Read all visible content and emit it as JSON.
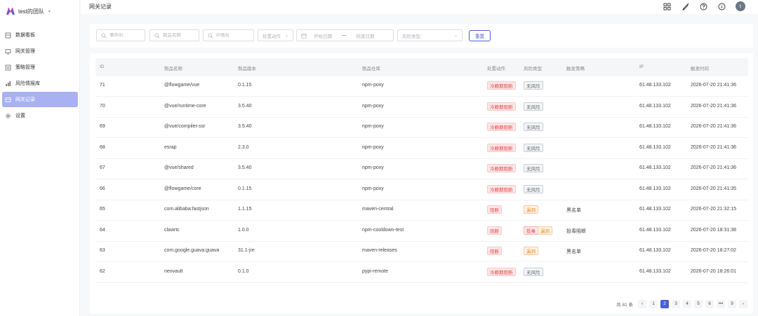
{
  "sidebar": {
    "team_name": "test的团队",
    "items": [
      {
        "label": "数据看板",
        "icon": "dashboard-icon"
      },
      {
        "label": "网关管理",
        "icon": "monitor-icon"
      },
      {
        "label": "策略管理",
        "icon": "policy-icon"
      },
      {
        "label": "风险情报库",
        "icon": "chart-icon"
      },
      {
        "label": "网关记录",
        "icon": "record-icon",
        "active": true
      },
      {
        "label": "设置",
        "icon": "gear-icon"
      }
    ]
  },
  "header": {
    "title": "网关记录",
    "avatar_letter": "t"
  },
  "filters": {
    "event_id_placeholder": "事件ID",
    "product_name_placeholder": "制品名称",
    "ip_placeholder": "IP地址",
    "action_placeholder": "处置动作",
    "start_date_placeholder": "开始日期",
    "date_separator": "—",
    "end_date_placeholder": "结束日期",
    "risk_type_placeholder": "风险类型",
    "reset_label": "重置"
  },
  "table": {
    "columns": {
      "id": "ID",
      "name": "制品名称",
      "version": "制品版本",
      "repo": "制品仓库",
      "action": "处置动作",
      "risk": "风险类型",
      "policy": "触发策略",
      "ip": "IP",
      "time": "触发时间"
    },
    "rows": [
      {
        "id": "71",
        "name": "@flowgame/vue",
        "version": "0.1.15",
        "repo": "npm-poxy",
        "action": "冷静期阻断",
        "action_color": "red",
        "risks": [
          {
            "label": "无风险",
            "color": "gray"
          }
        ],
        "policy": "",
        "ip": "61.48.133.102",
        "time": "2026-07-20 21:41:36"
      },
      {
        "id": "70",
        "name": "@vue/runtime-core",
        "version": "3.5.40",
        "repo": "npm-poxy",
        "action": "冷静期阻断",
        "action_color": "red",
        "risks": [
          {
            "label": "无风险",
            "color": "gray"
          }
        ],
        "policy": "",
        "ip": "61.48.133.102",
        "time": "2026-07-20 21:41:36"
      },
      {
        "id": "69",
        "name": "@vue/compiler-ssr",
        "version": "3.5.40",
        "repo": "npm-poxy",
        "action": "冷静期阻断",
        "action_color": "red",
        "risks": [
          {
            "label": "无风险",
            "color": "gray"
          }
        ],
        "policy": "",
        "ip": "61.48.133.102",
        "time": "2026-07-20 21:41:36"
      },
      {
        "id": "68",
        "name": "esrap",
        "version": "2.3.0",
        "repo": "npm-poxy",
        "action": "冷静期阻断",
        "action_color": "red",
        "risks": [
          {
            "label": "无风险",
            "color": "gray"
          }
        ],
        "policy": "",
        "ip": "61.48.133.102",
        "time": "2026-07-20 21:41:36"
      },
      {
        "id": "67",
        "name": "@vue/shared",
        "version": "3.5.40",
        "repo": "npm-poxy",
        "action": "冷静期阻断",
        "action_color": "red",
        "risks": [
          {
            "label": "无风险",
            "color": "gray"
          }
        ],
        "policy": "",
        "ip": "61.48.133.102",
        "time": "2026-07-20 21:41:36"
      },
      {
        "id": "66",
        "name": "@flowgame/core",
        "version": "0.1.15",
        "repo": "npm-poxy",
        "action": "冷静期阻断",
        "action_color": "red",
        "risks": [
          {
            "label": "无风险",
            "color": "gray"
          }
        ],
        "policy": "",
        "ip": "61.48.133.102",
        "time": "2026-07-20 21:41:35"
      },
      {
        "id": "65",
        "name": "com.alibaba:fastjson",
        "version": "1.1.15",
        "repo": "maven-central",
        "action": "阻断",
        "action_color": "red",
        "risks": [
          {
            "label": "漏洞",
            "color": "orange"
          }
        ],
        "policy": "黑名单",
        "ip": "61.48.133.102",
        "time": "2026-07-20 21:32:15"
      },
      {
        "id": "64",
        "name": "clawrtc",
        "version": "1.0.0",
        "repo": "npm-cooldown-test",
        "action": "阻断",
        "action_color": "red",
        "risks": [
          {
            "label": "投毒",
            "color": "pink"
          },
          {
            "label": "漏洞",
            "color": "orange"
          }
        ],
        "policy": "投毒阻断",
        "ip": "61.48.133.102",
        "time": "2026-07-20 18:31:38"
      },
      {
        "id": "63",
        "name": "com.google.guava:guava",
        "version": "31.1-jre",
        "repo": "maven-releases",
        "action": "阻断",
        "action_color": "red",
        "risks": [
          {
            "label": "漏洞",
            "color": "orange"
          }
        ],
        "policy": "黑名单",
        "ip": "61.48.133.102",
        "time": "2026-07-20 18:27:02"
      },
      {
        "id": "62",
        "name": "neovault",
        "version": "0.1.0",
        "repo": "pypi-remote",
        "action": "冷静期阻断",
        "action_color": "red",
        "risks": [
          {
            "label": "无风险",
            "color": "gray"
          }
        ],
        "policy": "",
        "ip": "61.48.133.102",
        "time": "2026-07-20 18:26:01"
      }
    ]
  },
  "pagination": {
    "total_label": "共 81 条",
    "prev": "‹",
    "next": "›",
    "pages": [
      "1",
      "2",
      "3",
      "4",
      "5",
      "6",
      "•••",
      "9"
    ],
    "active_page": "2"
  }
}
